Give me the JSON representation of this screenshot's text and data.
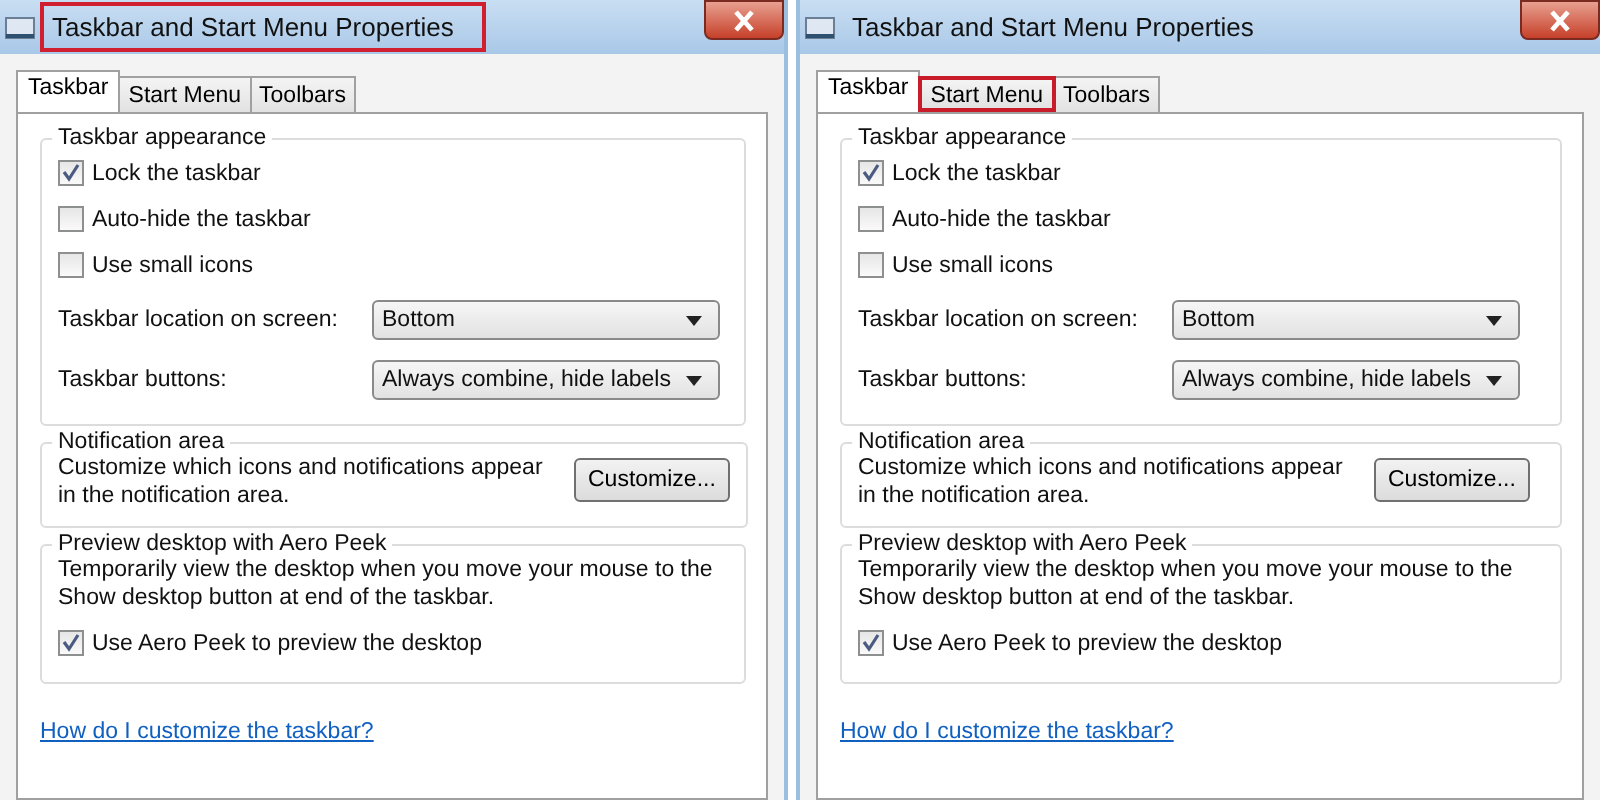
{
  "panels": [
    {
      "window": {
        "title": "Taskbar and Start Menu Properties",
        "title_highlighted": true
      },
      "tabs": [
        {
          "label": "Taskbar",
          "selected": true,
          "highlighted": false
        },
        {
          "label": "Start Menu",
          "selected": false,
          "highlighted": false
        },
        {
          "label": "Toolbars",
          "selected": false,
          "highlighted": false
        }
      ],
      "appearance": {
        "title": "Taskbar appearance",
        "checkboxes": [
          {
            "label": "Lock the taskbar",
            "checked": true
          },
          {
            "label": "Auto-hide the taskbar",
            "checked": false
          },
          {
            "label": "Use small icons",
            "checked": false
          }
        ],
        "dropdowns": [
          {
            "label": "Taskbar location on screen:",
            "value": "Bottom"
          },
          {
            "label": "Taskbar buttons:",
            "value": "Always combine, hide labels"
          }
        ]
      },
      "notification": {
        "title": "Notification area",
        "text": "Customize which icons and notifications appear in the notification area.",
        "button": "Customize..."
      },
      "aero_peek": {
        "title": "Preview desktop with Aero Peek",
        "text": "Temporarily view the desktop when you move your mouse to the Show desktop button at end of the taskbar.",
        "checkbox": {
          "label": "Use Aero Peek to preview the desktop",
          "checked": true
        }
      },
      "link": "How do I customize the taskbar?"
    },
    {
      "window": {
        "title": "Taskbar and Start Menu Properties",
        "title_highlighted": false
      },
      "tabs": [
        {
          "label": "Taskbar",
          "selected": true,
          "highlighted": false
        },
        {
          "label": "Start Menu",
          "selected": false,
          "highlighted": true
        },
        {
          "label": "Toolbars",
          "selected": false,
          "highlighted": false
        }
      ],
      "appearance": {
        "title": "Taskbar appearance",
        "checkboxes": [
          {
            "label": "Lock the taskbar",
            "checked": true
          },
          {
            "label": "Auto-hide the taskbar",
            "checked": false
          },
          {
            "label": "Use small icons",
            "checked": false
          }
        ],
        "dropdowns": [
          {
            "label": "Taskbar location on screen:",
            "value": "Bottom"
          },
          {
            "label": "Taskbar buttons:",
            "value": "Always combine, hide labels"
          }
        ]
      },
      "notification": {
        "title": "Notification area",
        "text": "Customize which icons and notifications appear in the notification area.",
        "button": "Customize..."
      },
      "aero_peek": {
        "title": "Preview desktop with Aero Peek",
        "text": "Temporarily view the desktop when you move your mouse to the Show desktop button at end of the taskbar.",
        "checkbox": {
          "label": "Use Aero Peek to preview the desktop",
          "checked": true
        }
      },
      "link": "How do I customize the taskbar?"
    }
  ]
}
